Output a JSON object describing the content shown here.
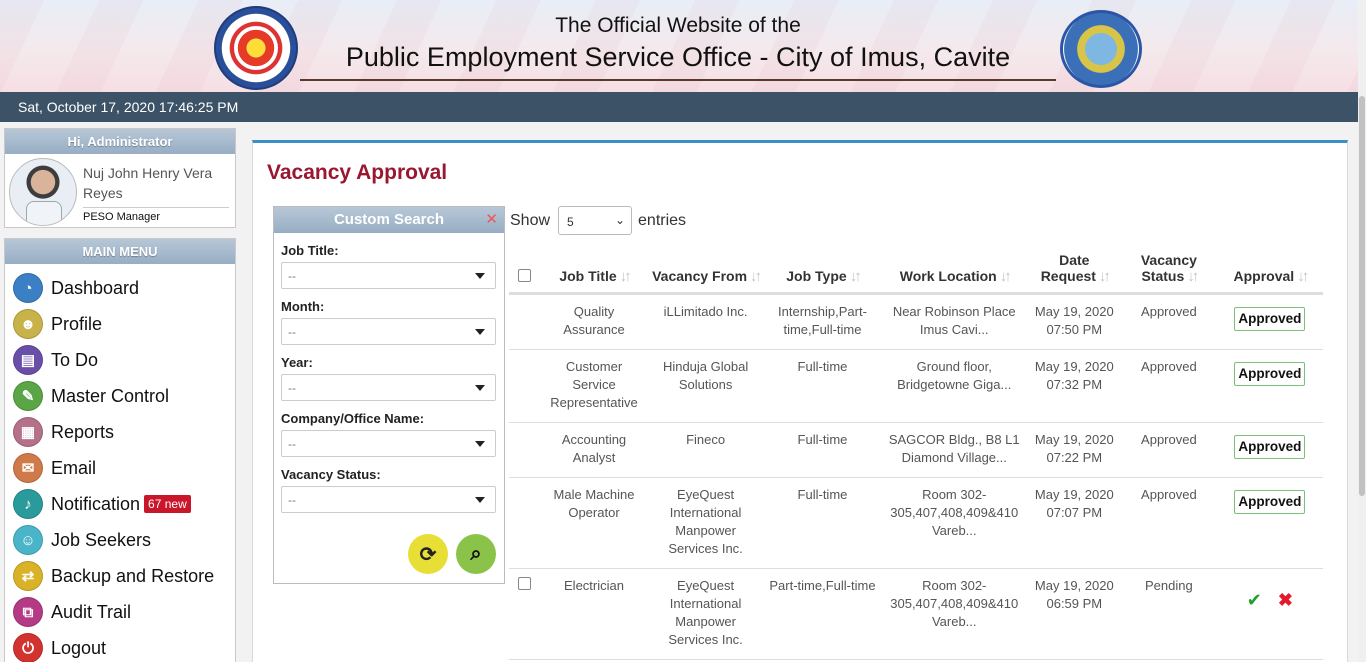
{
  "header": {
    "line1": "The Official Website of the",
    "line2": "Public Employment Service Office - City of Imus, Cavite",
    "left_logo": "peso-seal-icon",
    "right_logo": "imus-city-seal-icon"
  },
  "datetime": "Sat, October 17, 2020 17:46:25 PM",
  "profile": {
    "greeting": "Hi, Administrator",
    "name": "Nuj John Henry Vera Reyes",
    "role": "PESO Manager"
  },
  "menu": {
    "title": "MAIN MENU",
    "items": [
      {
        "label": "Dashboard",
        "icon": "dashboard-icon",
        "color": "#3b7fc4",
        "glyph": "◔"
      },
      {
        "label": "Profile",
        "icon": "profile-icon",
        "color": "#c8b24a",
        "glyph": "☻"
      },
      {
        "label": "To Do",
        "icon": "todo-icon",
        "color": "#6a4fa8",
        "glyph": "▤"
      },
      {
        "label": "Master Control",
        "icon": "wrench-icon",
        "color": "#5aa545",
        "glyph": "✎"
      },
      {
        "label": "Reports",
        "icon": "reports-icon",
        "color": "#b5708a",
        "glyph": "▦"
      },
      {
        "label": "Email",
        "icon": "email-icon",
        "color": "#d07a4a",
        "glyph": "✉"
      },
      {
        "label": "Notification",
        "icon": "bell-icon",
        "color": "#2a9a9a",
        "glyph": "♪",
        "badge": "67 new"
      },
      {
        "label": "Job Seekers",
        "icon": "job-seekers-icon",
        "color": "#4ab5c9",
        "glyph": "☺"
      },
      {
        "label": "Backup and Restore",
        "icon": "backup-icon",
        "color": "#d9b227",
        "glyph": "⇄"
      },
      {
        "label": "Audit Trail",
        "icon": "audit-trail-icon",
        "color": "#b43a86",
        "glyph": "⧉"
      },
      {
        "label": "Logout",
        "icon": "power-icon",
        "color": "#d2332e",
        "glyph": "⏻"
      }
    ]
  },
  "main": {
    "title": "Vacancy Approval",
    "search": {
      "title": "Custom Search",
      "fields": [
        {
          "label": "Job Title:",
          "value": "--"
        },
        {
          "label": "Month:",
          "value": "--"
        },
        {
          "label": "Year:",
          "value": "--"
        },
        {
          "label": "Company/Office Name:",
          "value": "--"
        },
        {
          "label": "Vacancy Status:",
          "value": "--"
        }
      ]
    },
    "show": {
      "prefix": "Show",
      "value": "5",
      "suffix": "entries"
    },
    "columns": [
      "Job Title",
      "Vacancy From",
      "Job Type",
      "Work Location",
      "Date Request",
      "Vacancy Status",
      "Approval"
    ],
    "rows": [
      {
        "title": "Quality Assurance",
        "from": "iLLimitado Inc.",
        "type": "Internship,Part-time,Full-time",
        "location": "Near Robinson Place Imus Cavi...",
        "date": "May 19, 2020 07:50 PM",
        "status": "Approved",
        "approval": "Approved"
      },
      {
        "title": "Customer Service Representative",
        "from": "Hinduja Global Solutions",
        "type": "Full-time",
        "location": "Ground floor, Bridgetowne Giga...",
        "date": "May 19, 2020 07:32 PM",
        "status": "Approved",
        "approval": "Approved"
      },
      {
        "title": "Accounting Analyst",
        "from": "Fineco",
        "type": "Full-time",
        "location": "SAGCOR Bldg., B8 L1 Diamond Village...",
        "date": "May 19, 2020 07:22 PM",
        "status": "Approved",
        "approval": "Approved"
      },
      {
        "title": "Male Machine Operator",
        "from": "EyeQuest International Manpower Services Inc.",
        "type": "Full-time",
        "location": "Room 302-305,407,408,409&410 Vareb...",
        "date": "May 19, 2020 07:07 PM",
        "status": "Approved",
        "approval": "Approved"
      },
      {
        "title": "Electrician",
        "from": "EyeQuest International Manpower Services Inc.",
        "type": "Part-time,Full-time",
        "location": "Room 302-305,407,408,409&410 Vareb...",
        "date": "May 19, 2020 06:59 PM",
        "status": "Pending",
        "approval": ""
      }
    ]
  }
}
